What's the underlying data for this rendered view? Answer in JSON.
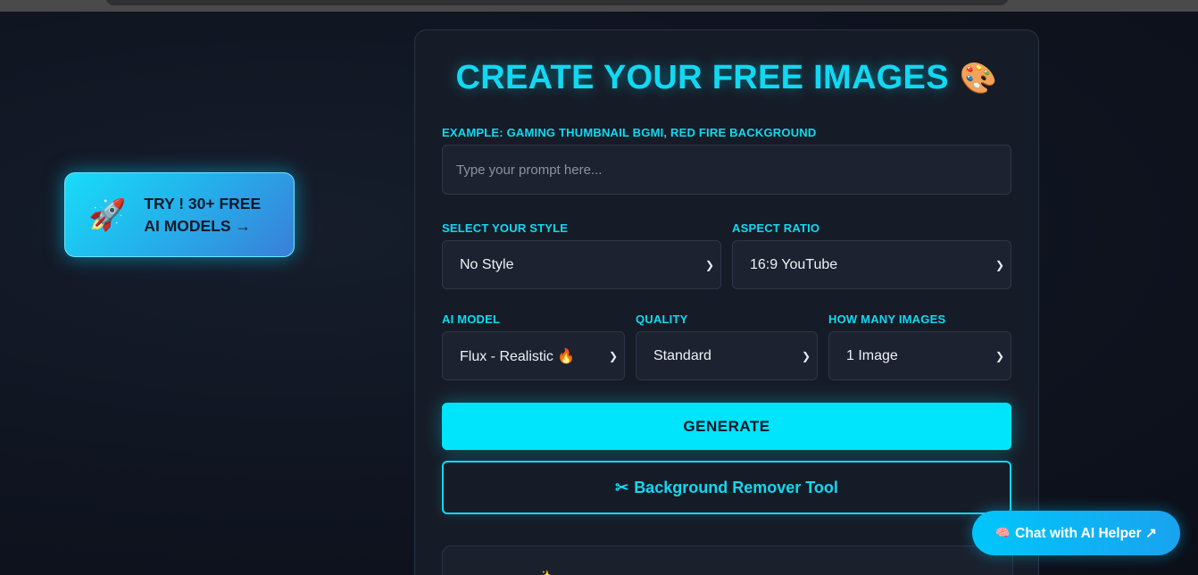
{
  "promo": {
    "icon": "rocket-icon",
    "emoji": "🚀",
    "label": "TRY ! 30+ FREE AI MODELS →"
  },
  "form": {
    "title": "CREATE YOUR FREE IMAGES",
    "title_icon": "palette-icon",
    "title_emoji": "🎨",
    "prompt": {
      "label": "EXAMPLE: GAMING THUMBNAIL BGMI, RED FIRE BACKGROUND",
      "placeholder": "Type your prompt here...",
      "value": ""
    },
    "style": {
      "label": "SELECT YOUR STYLE",
      "value": "No Style"
    },
    "aspect": {
      "label": "ASPECT RATIO",
      "value": "16:9 YouTube"
    },
    "model": {
      "label": "AI MODEL",
      "value": "Flux - Realistic 🔥"
    },
    "quality": {
      "label": "QUALITY",
      "value": "Standard"
    },
    "count": {
      "label": "HOW MANY IMAGES",
      "value": "1 Image"
    },
    "generate_label": "GENERATE",
    "bg_tool": {
      "icon": "scissors-icon",
      "emoji": "✂",
      "label": "Background Remover Tool"
    },
    "panel_icon": "sparkle-icon",
    "panel_emoji": "✨"
  },
  "chat": {
    "icon": "brain-icon",
    "emoji": "🧠",
    "label": "Chat with AI Helper ↗"
  },
  "colors": {
    "accent": "#12d8f2",
    "button": "#00e4fc",
    "background": "#0f1420",
    "card": "#161c27",
    "field": "#1c2230"
  }
}
